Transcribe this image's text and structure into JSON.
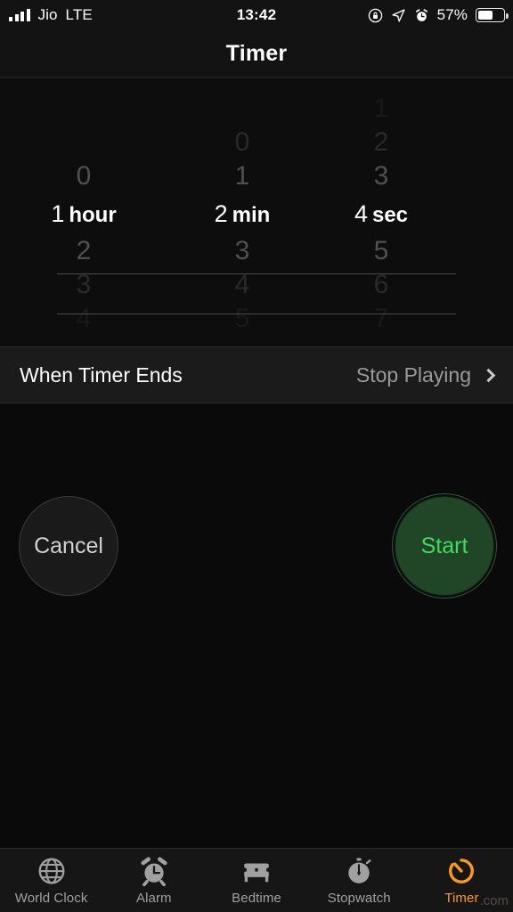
{
  "status_bar": {
    "carrier": "Jio",
    "network": "LTE",
    "time": "13:42",
    "battery_percent": "57%",
    "battery_level": 57,
    "icons": [
      "signal-bars-icon",
      "rotation-lock-icon",
      "location-arrow-icon",
      "alarm-clock-icon",
      "battery-icon"
    ]
  },
  "nav": {
    "title": "Timer"
  },
  "picker": {
    "hours": {
      "above": [
        "0"
      ],
      "selected_value": "1",
      "selected_unit": "hour",
      "below": [
        "2",
        "3",
        "4"
      ]
    },
    "minutes": {
      "above": [
        "0",
        "1"
      ],
      "selected_value": "2",
      "selected_unit": "min",
      "below": [
        "3",
        "4",
        "5"
      ]
    },
    "seconds": {
      "above": [
        "1",
        "2",
        "3"
      ],
      "selected_value": "4",
      "selected_unit": "sec",
      "below": [
        "5",
        "6",
        "7"
      ]
    }
  },
  "setting_row": {
    "label": "When Timer Ends",
    "value": "Stop Playing",
    "chevron": "chevron-right-icon"
  },
  "actions": {
    "cancel_label": "Cancel",
    "start_label": "Start",
    "start_color": "#3edc5f",
    "start_fill": "#204527"
  },
  "tabbar": {
    "items": [
      {
        "label": "World Clock",
        "icon": "globe-icon",
        "active": false
      },
      {
        "label": "Alarm",
        "icon": "alarm-clock-icon",
        "active": false
      },
      {
        "label": "Bedtime",
        "icon": "bed-icon",
        "active": false
      },
      {
        "label": "Stopwatch",
        "icon": "stopwatch-icon",
        "active": false
      },
      {
        "label": "Timer",
        "icon": "timer-icon",
        "active": true
      }
    ],
    "active_color": "#ff9a12",
    "inactive_color": "#a0a0a0"
  },
  "watermark": {
    "text": ".com"
  }
}
